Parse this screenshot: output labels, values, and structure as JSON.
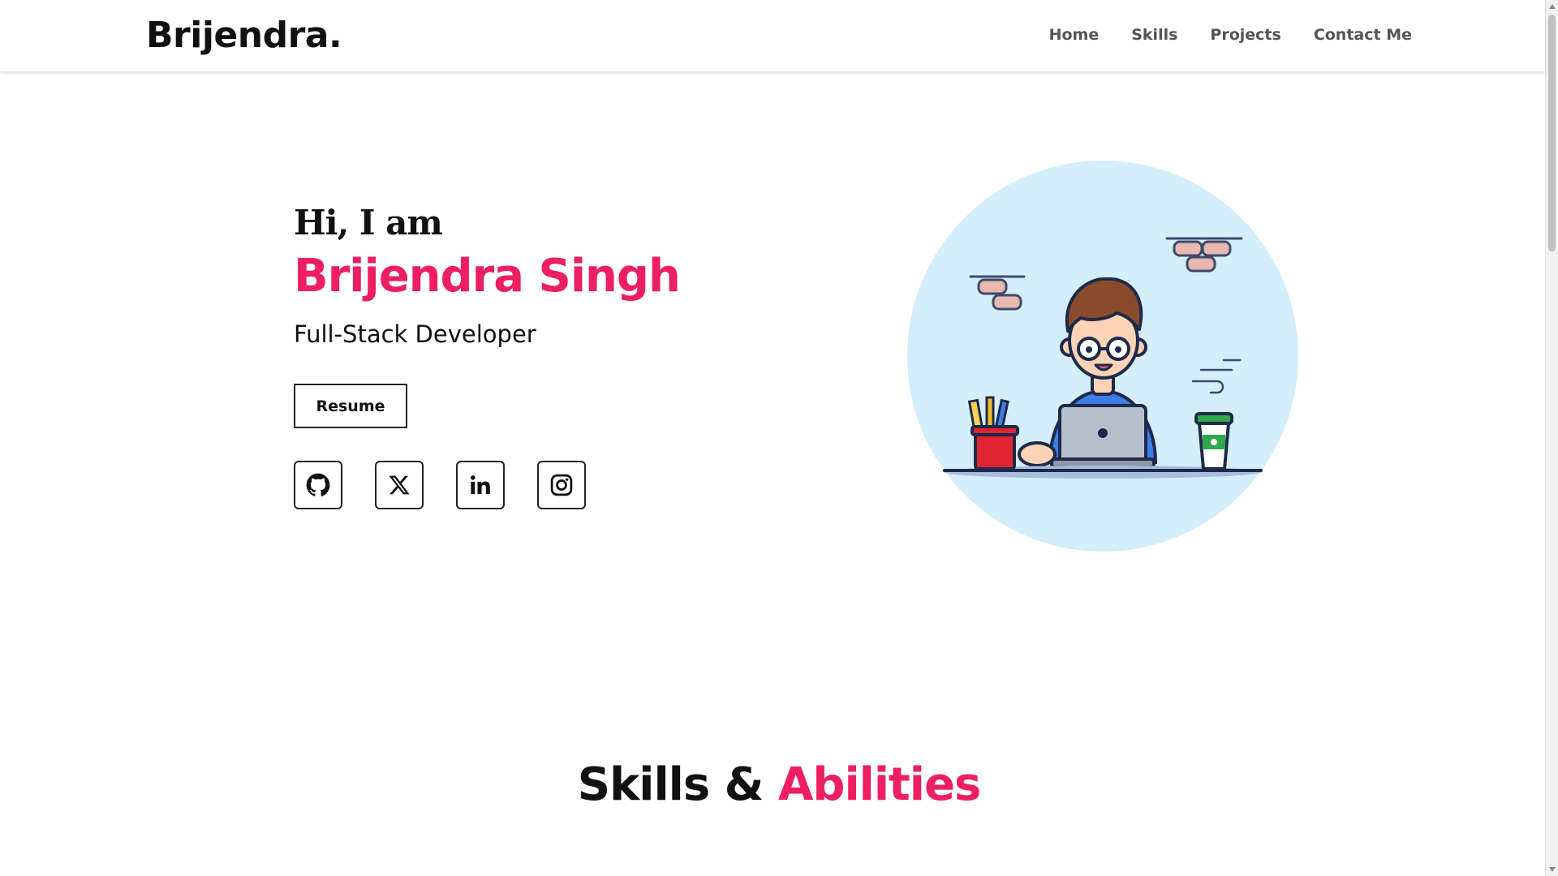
{
  "header": {
    "logo": "Brijendra.",
    "nav": [
      {
        "label": "Home"
      },
      {
        "label": "Skills"
      },
      {
        "label": "Projects"
      },
      {
        "label": "Contact Me"
      }
    ]
  },
  "hero": {
    "greeting": "Hi, I am",
    "name": "Brijendra Singh",
    "role": "Full-Stack Developer",
    "resume_label": "Resume",
    "socials": [
      "github-icon",
      "x-twitter-icon",
      "linkedin-icon",
      "instagram-icon"
    ]
  },
  "skills_section": {
    "title_part1": "Skills &",
    "title_part2": "Abilities"
  },
  "colors": {
    "accent": "#ed1e62",
    "text": "#111111",
    "nav_text": "#555555",
    "illustration_bg": "#d4eefc"
  }
}
